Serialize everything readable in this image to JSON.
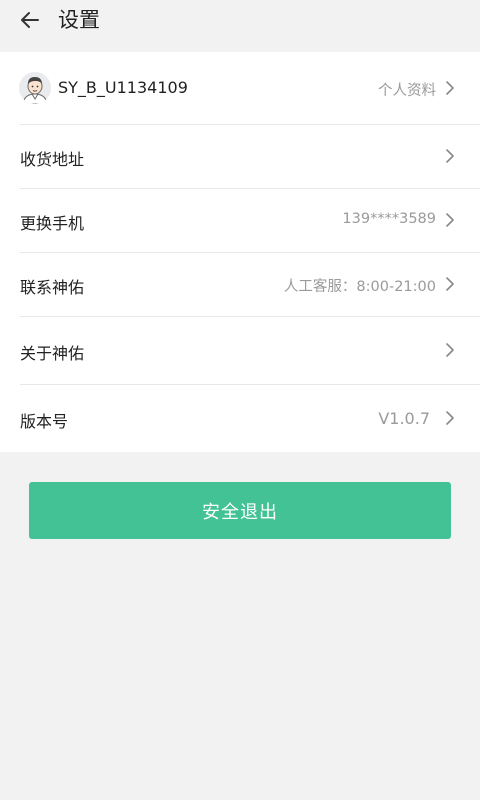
{
  "header": {
    "back_icon": "arrow-left-icon",
    "title": "设置"
  },
  "profile": {
    "username": "SY_B_U1134109",
    "action_label": "个人资料",
    "avatar_icon": "cartoon-man-avatar"
  },
  "menu": {
    "address": {
      "label": "收货地址",
      "value": ""
    },
    "phone": {
      "label": "更换手机",
      "value": "139****3589"
    },
    "contact": {
      "label": "联系神佑",
      "value": "人工客服：8:00-21:00"
    },
    "about": {
      "label": "关于神佑",
      "value": ""
    },
    "version": {
      "label": "版本号",
      "value": "V1.0.7"
    }
  },
  "logout": {
    "label": "安全退出"
  },
  "colors": {
    "accent": "#43c296",
    "background": "#f2f2f2",
    "card": "#ffffff",
    "secondary_text": "#9a9a9a"
  }
}
